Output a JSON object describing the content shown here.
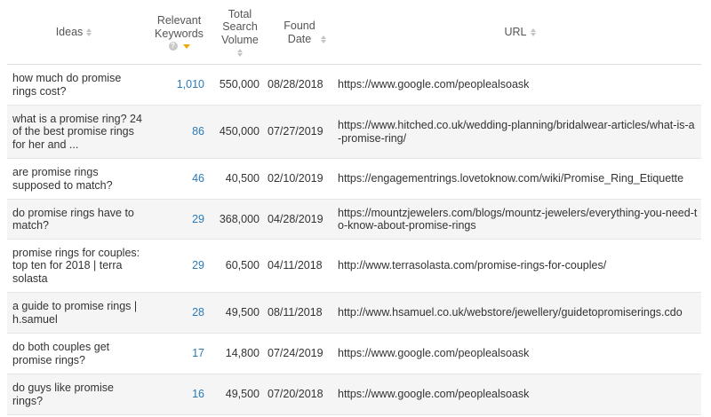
{
  "headers": {
    "ideas": "Ideas",
    "relevant_keywords": "Relevant Keywords",
    "total_search_volume": "Total Search Volume",
    "found_date": "Found Date",
    "url": "URL"
  },
  "colors": {
    "link_blue": "#2a7ab8",
    "active_sort": "#f0a800",
    "row_alt": "#f5f5f5"
  },
  "rows": [
    {
      "idea": "how much do promise rings cost?",
      "keywords": "1,010",
      "volume": "550,000",
      "date": "08/28/2018",
      "url": "https://www.google.com/peoplealsoask"
    },
    {
      "idea": "what is a promise ring? 24 of the best promise rings for her and ...",
      "keywords": "86",
      "volume": "450,000",
      "date": "07/27/2019",
      "url": "https://www.hitched.co.uk/wedding-planning/bridalwear-articles/what-is-a-promise-ring/"
    },
    {
      "idea": "are promise rings supposed to match?",
      "keywords": "46",
      "volume": "40,500",
      "date": "02/10/2019",
      "url": "https://engagementrings.lovetoknow.com/wiki/Promise_Ring_Etiquette"
    },
    {
      "idea": "do promise rings have to match?",
      "keywords": "29",
      "volume": "368,000",
      "date": "04/28/2019",
      "url": "https://mountzjewelers.com/blogs/mountz-jewelers/everything-you-need-to-know-about-promise-rings"
    },
    {
      "idea": "promise rings for couples: top ten for 2018 | terra solasta",
      "keywords": "29",
      "volume": "60,500",
      "date": "04/11/2018",
      "url": "http://www.terrasolasta.com/promise-rings-for-couples/"
    },
    {
      "idea": "a guide to promise rings | h.samuel",
      "keywords": "28",
      "volume": "49,500",
      "date": "08/11/2018",
      "url": "http://www.hsamuel.co.uk/webstore/jewellery/guidetopromiserings.cdo"
    },
    {
      "idea": "do both couples get promise rings?",
      "keywords": "17",
      "volume": "14,800",
      "date": "07/24/2019",
      "url": "https://www.google.com/peoplealsoask"
    },
    {
      "idea": "do guys like promise rings?",
      "keywords": "16",
      "volume": "49,500",
      "date": "07/20/2018",
      "url": "https://www.google.com/peoplealsoask"
    }
  ]
}
